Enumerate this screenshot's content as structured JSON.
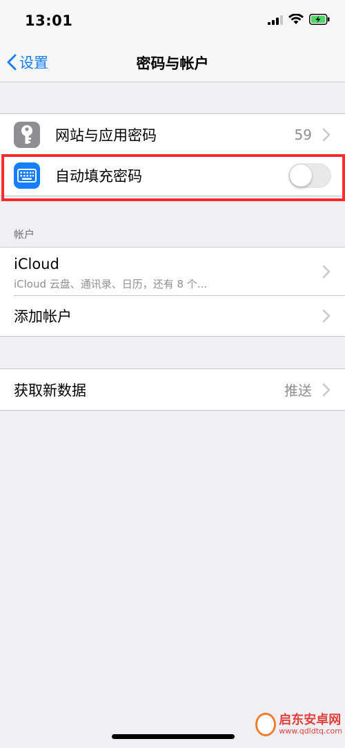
{
  "status_bar": {
    "time": "13:01"
  },
  "nav": {
    "back_label": "设置",
    "title": "密码与帐户"
  },
  "passwords_group": {
    "website_passwords_label": "网站与应用密码",
    "website_passwords_count": "59",
    "autofill_label": "自动填充密码",
    "autofill_enabled": false
  },
  "accounts_section": {
    "header": "帐户",
    "icloud_title": "iCloud",
    "icloud_subtitle": "iCloud 云盘、通讯录、日历，还有 8 个...",
    "add_account_label": "添加帐户"
  },
  "fetch_group": {
    "fetch_label": "获取新数据",
    "fetch_value": "推送"
  },
  "watermark": {
    "title": "启东安卓网",
    "url": "www.qdldtq.com"
  },
  "colors": {
    "accent": "#157efb",
    "highlight": "#ff2a2a",
    "background": "#efeff4"
  }
}
